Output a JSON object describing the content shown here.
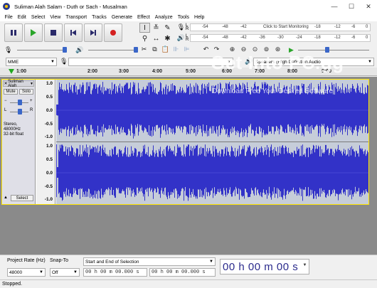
{
  "window": {
    "title": "Suliman Alah Salam - Duth or Sach - Musalman",
    "minimize": "—",
    "maximize": "☐",
    "close": "✕"
  },
  "menu": [
    "File",
    "Edit",
    "Select",
    "View",
    "Transport",
    "Tracks",
    "Generate",
    "Effect",
    "Analyze",
    "Tools",
    "Help"
  ],
  "transport": {
    "buttons": [
      "pause",
      "play",
      "stop",
      "skip-start",
      "skip-end",
      "record"
    ]
  },
  "meters": {
    "record": {
      "ticks": [
        "-54",
        "-48",
        "-42",
        "-18",
        "-12",
        "-6",
        "0"
      ],
      "click_text": "Click to Start Monitoring",
      "left_channel": "L",
      "right_channel": "R"
    },
    "playback": {
      "ticks": [
        "-54",
        "-48",
        "-42",
        "-36",
        "-30",
        "-24",
        "-18",
        "-12",
        "-6",
        "0"
      ],
      "left_channel": "L",
      "right_channel": "R"
    }
  },
  "device": {
    "host": "MME",
    "input": "",
    "output": "Speakers (High Definition Audio"
  },
  "ruler": {
    "ticks": [
      "1:00",
      "2:00",
      "3:00",
      "4:00",
      "5:00",
      "6:00",
      "7:00",
      "8:00",
      "9:00"
    ]
  },
  "track": {
    "name": "Suliman Alah",
    "mute": "Mute",
    "solo": "Solo",
    "pan_left": "L",
    "pan_right": "R",
    "info_line1": "Stereo, 48000Hz",
    "info_line2": "32-bit float",
    "select": "Select",
    "close": "✕",
    "collapse": "▲",
    "vruler_ticks": [
      "1.0",
      "0.5",
      "0.0",
      "-0.5",
      "-1.0"
    ],
    "colors": {
      "wave": "#3232c8",
      "background": "#c6cdd9",
      "border": "#fee500"
    }
  },
  "selection_bar": {
    "project_rate_label": "Project Rate (Hz)",
    "project_rate_value": "48000",
    "snap_to_label": "Snap-To",
    "snap_to_value": "Off",
    "selection_mode": "Start and End of Selection",
    "start_time": "00 h 00 m 00.000 s",
    "end_time": "00 h 00 m 00.000 s",
    "audio_position": "00 h 00 m 00 s"
  },
  "status": "Stopped.",
  "watermark": {
    "line1": "Get Into PC.gg",
    "line2": "Download Free Your Desired Software"
  }
}
